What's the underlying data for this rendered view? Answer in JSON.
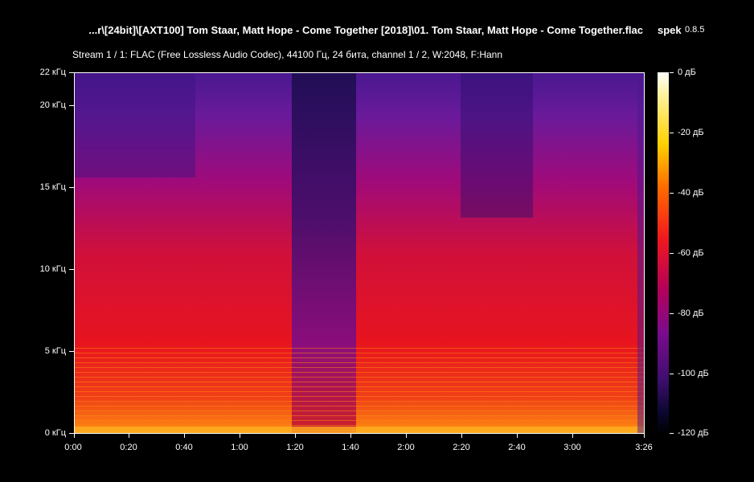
{
  "header": {
    "file_title": "...r\\[24bit]\\[AXT100] Tom Staar, Matt Hope - Come Together [2018]\\01. Tom Staar, Matt Hope - Come Together.flac",
    "app_name": "spek",
    "app_version": "0.8.5"
  },
  "stream_info": "Stream 1 / 1: FLAC (Free Lossless Audio Codec), 44100 Гц, 24 бита, channel 1 / 2, W:2048, F:Hann",
  "y_axis": {
    "labels": [
      "22 кГц",
      "20 кГц",
      "15 кГц",
      "10 кГц",
      "5 кГц",
      "0 кГц"
    ],
    "values_khz": [
      22,
      20,
      15,
      10,
      5,
      0
    ]
  },
  "x_axis": {
    "labels": [
      "0:00",
      "0:20",
      "0:40",
      "1:00",
      "1:20",
      "1:40",
      "2:00",
      "2:20",
      "2:40",
      "3:00",
      "3:26"
    ],
    "values_sec": [
      0,
      20,
      40,
      60,
      80,
      100,
      120,
      140,
      160,
      180,
      206
    ]
  },
  "colorbar": {
    "labels": [
      "0 дБ",
      "-20 дБ",
      "-40 дБ",
      "-60 дБ",
      "-80 дБ",
      "-100 дБ",
      "-120 дБ"
    ],
    "values_db": [
      0,
      -20,
      -40,
      -60,
      -80,
      -100,
      -120
    ]
  },
  "colors": {
    "background": "#000000",
    "text": "#ffffff"
  }
}
